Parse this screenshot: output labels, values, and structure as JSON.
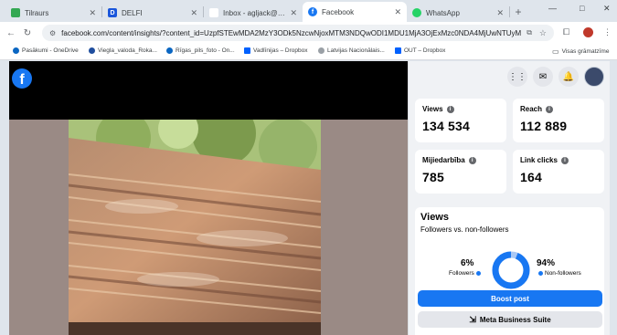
{
  "browser": {
    "tabs": [
      {
        "title": "Tilraurs",
        "favicon": "green-square-icon",
        "active": false
      },
      {
        "title": "DELFI",
        "favicon": "delfi-d-icon",
        "active": false
      },
      {
        "title": "Inbox - agljack@gmail.c",
        "favicon": "gmail-m-icon",
        "active": false
      },
      {
        "title": "Facebook",
        "favicon": "facebook-f-icon",
        "active": true
      },
      {
        "title": "WhatsApp",
        "favicon": "whatsapp-icon",
        "active": false
      }
    ],
    "new_tab": "+",
    "window": {
      "minimize": "—",
      "maximize": "□",
      "close": "✕"
    },
    "address": "facebook.com/content/insights/?content_id=UzpfSTEwMDA2MzY3ODk5NzcwNjoxMTM3NDQwODI1MDU1MjA3OjExMzc0NDA4MjUwNTUyMDc",
    "bookmarks": [
      {
        "label": "Pasākumi - OneDrive"
      },
      {
        "label": "Viegla_valoda_Roka..."
      },
      {
        "label": "Rīgas_pils_foto - On..."
      },
      {
        "label": "Vadlīnijas – Dropbox"
      },
      {
        "label": "Latvijas Nacionālais..."
      },
      {
        "label": "OUT – Dropbox"
      }
    ],
    "bookmark_folder": "Visas grāmatzīme"
  },
  "facebook": {
    "logo": "f",
    "stats": [
      {
        "label": "Views",
        "value": "134 534"
      },
      {
        "label": "Reach",
        "value": "112 889"
      },
      {
        "label": "Mijiedarbība",
        "value": "785"
      },
      {
        "label": "Link clicks",
        "value": "164"
      }
    ],
    "views_section": {
      "title": "Views",
      "subtitle": "Followers vs. non-followers",
      "followers_pct": "6%",
      "followers_label": "Followers",
      "non_followers_pct": "94%",
      "non_followers_label": "Non-followers",
      "followers_fraction": 0.06
    },
    "boost_label": "Boost post",
    "mbs_label": "Meta Business Suite"
  },
  "colors": {
    "fb_blue": "#1877f2",
    "donut_light": "#a9c8f5"
  }
}
